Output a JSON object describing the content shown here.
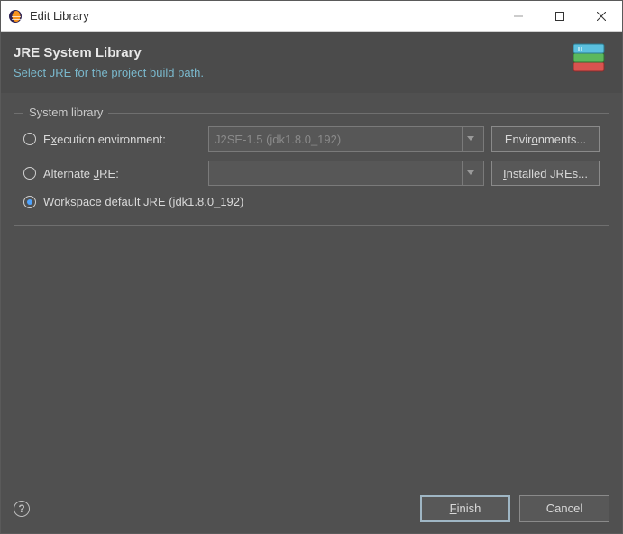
{
  "window": {
    "title": "Edit Library"
  },
  "banner": {
    "heading": "JRE System Library",
    "subheading": "Select JRE for the project build path."
  },
  "group": {
    "legend": "System library",
    "exec_env": {
      "label_pre": "E",
      "label_mn": "x",
      "label_post": "ecution environment:",
      "value": "J2SE-1.5 (jdk1.8.0_192)",
      "button_pre": "Envir",
      "button_mn": "o",
      "button_post": "nments..."
    },
    "alt_jre": {
      "label_pre": "Alternate ",
      "label_mn": "J",
      "label_post": "RE:",
      "value": "",
      "button_mn": "I",
      "button_post": "nstalled JREs..."
    },
    "workspace": {
      "label_pre": "Workspace ",
      "label_mn": "d",
      "label_post": "efault JRE (jdk1.8.0_192)"
    }
  },
  "footer": {
    "finish_mn": "F",
    "finish_post": "inish",
    "cancel": "Cancel"
  }
}
